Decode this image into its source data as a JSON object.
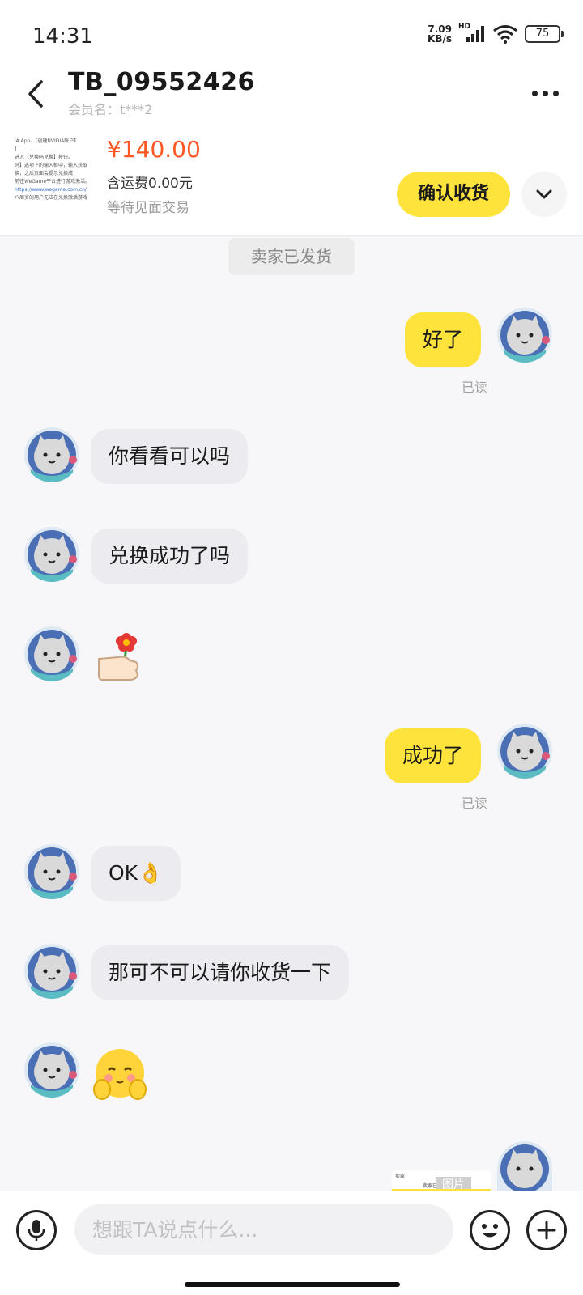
{
  "status_bar": {
    "time": "14:31",
    "net_speed_value": "7.09",
    "net_speed_unit": "KB/s",
    "network_label": "HD",
    "battery": "75"
  },
  "header": {
    "title": "TB_09552426",
    "member_name": "会员名：t***2"
  },
  "order": {
    "price": "¥140.00",
    "shipping": "含运费0.00元",
    "status": "等待见面交易",
    "confirm_label": "确认收货",
    "thumbnail_lines": [
      "iA  App、【创建NVIDIA账户】",
      "]",
      "进入【兑换码兑换】按钮。",
      "码】选项下的输入框中，输入获取",
      "换，之后页面会提示兑换成",
      "前往WeGame平台进行游戏激活。",
      "https://www.wegame.com.cn/",
      "八周岁的用户无法在兑换激活游戏"
    ]
  },
  "system_message": "卖家已发货",
  "messages": [
    {
      "from": "me",
      "type": "text",
      "text": "好了",
      "read": "已读"
    },
    {
      "from": "other",
      "type": "text",
      "text": "你看看可以吗"
    },
    {
      "from": "other",
      "type": "text",
      "text": "兑换成功了吗"
    },
    {
      "from": "other",
      "type": "emoji",
      "emoji": "flower-hand-icon"
    },
    {
      "from": "me",
      "type": "text",
      "text": "成功了",
      "read": "已读"
    },
    {
      "from": "other",
      "type": "text",
      "text": "OK👌"
    },
    {
      "from": "other",
      "type": "text",
      "text": "那可不可以请你收货一下"
    },
    {
      "from": "other",
      "type": "emoji",
      "emoji": "shy-face-icon"
    },
    {
      "from": "me",
      "type": "image",
      "tag": "图片",
      "mini_left": "卖家",
      "mini_center": "卖家已发货"
    }
  ],
  "input": {
    "placeholder": "想跟TA说点什么..."
  },
  "colors": {
    "accent": "#ffe33d",
    "price": "#ff5722",
    "background": "#f7f7f9",
    "bubble_other": "#ececf0"
  },
  "icons": [
    "back-arrow-icon",
    "more-dots-icon",
    "chevron-down-icon",
    "microphone-icon",
    "emoji-icon",
    "plus-icon",
    "signal-icon",
    "wifi-icon",
    "battery-icon"
  ]
}
